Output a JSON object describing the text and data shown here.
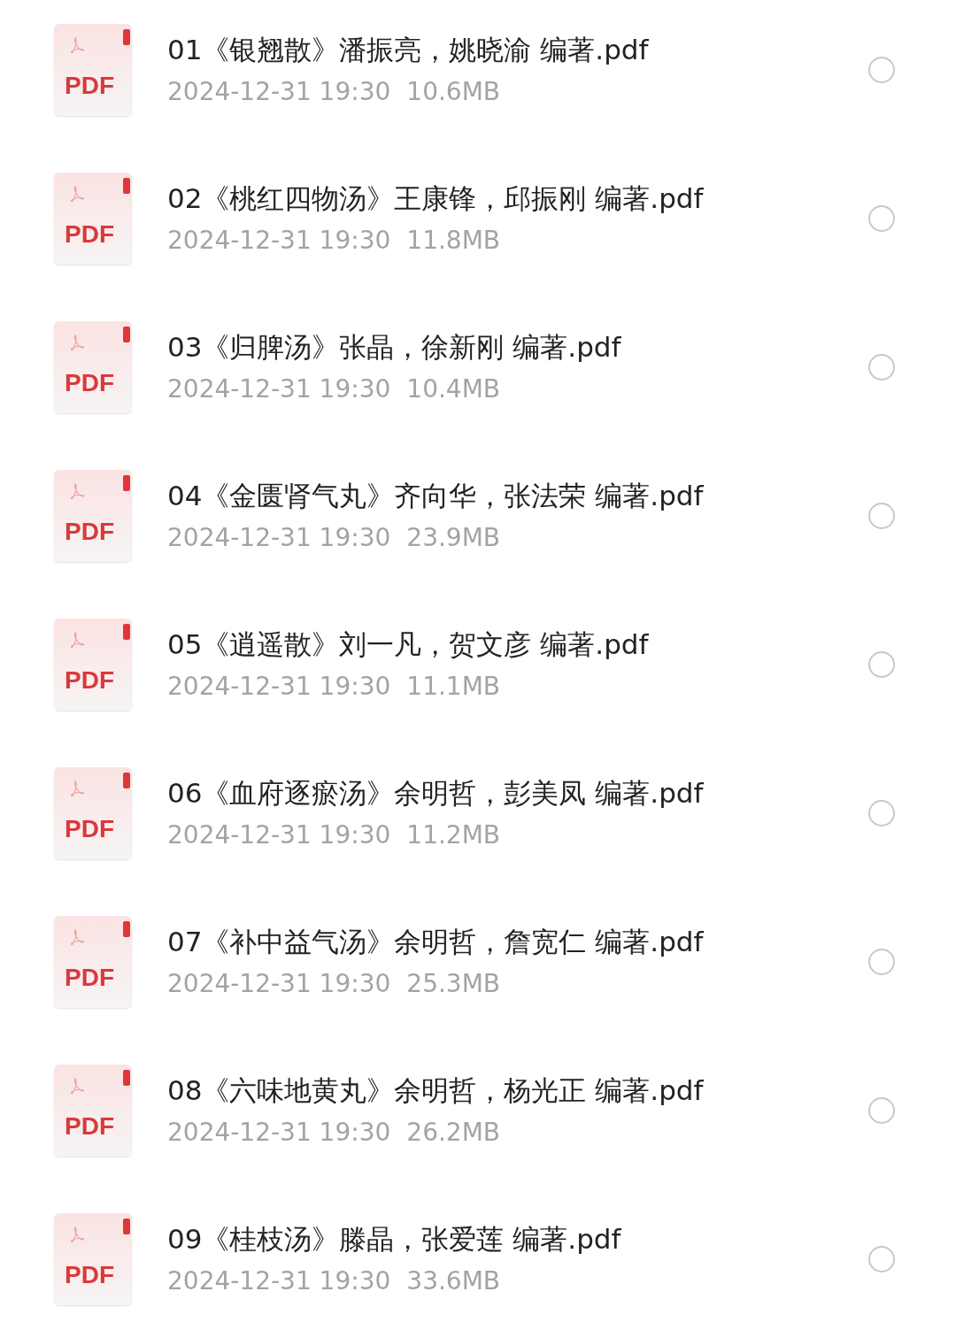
{
  "files": [
    {
      "badge": "PDF",
      "name": "01《银翘散》潘振亮，姚晓渝 编著.pdf",
      "date": "2024-12-31 19:30",
      "size": "10.6MB",
      "selected": false
    },
    {
      "badge": "PDF",
      "name": "02《桃红四物汤》王康锋，邱振刚 编著.pdf",
      "date": "2024-12-31 19:30",
      "size": "11.8MB",
      "selected": false
    },
    {
      "badge": "PDF",
      "name": "03《归脾汤》张晶，徐新刚 编著.pdf",
      "date": "2024-12-31 19:30",
      "size": "10.4MB",
      "selected": false
    },
    {
      "badge": "PDF",
      "name": "04《金匮肾气丸》齐向华，张法荣 编著.pdf",
      "date": "2024-12-31 19:30",
      "size": "23.9MB",
      "selected": false
    },
    {
      "badge": "PDF",
      "name": "05《逍遥散》刘一凡，贺文彦 编著.pdf",
      "date": "2024-12-31 19:30",
      "size": "11.1MB",
      "selected": false
    },
    {
      "badge": "PDF",
      "name": "06《血府逐瘀汤》余明哲，彭美凤 编著.pdf",
      "date": "2024-12-31 19:30",
      "size": "11.2MB",
      "selected": false
    },
    {
      "badge": "PDF",
      "name": "07《补中益气汤》余明哲，詹宽仁 编著.pdf",
      "date": "2024-12-31 19:30",
      "size": "25.3MB",
      "selected": false
    },
    {
      "badge": "PDF",
      "name": "08《六味地黄丸》余明哲，杨光正 编著.pdf",
      "date": "2024-12-31 19:30",
      "size": "26.2MB",
      "selected": false
    },
    {
      "badge": "PDF",
      "name": "09《桂枝汤》滕晶，张爱莲 编著.pdf",
      "date": "2024-12-31 19:30",
      "size": "33.6MB",
      "selected": false
    }
  ]
}
